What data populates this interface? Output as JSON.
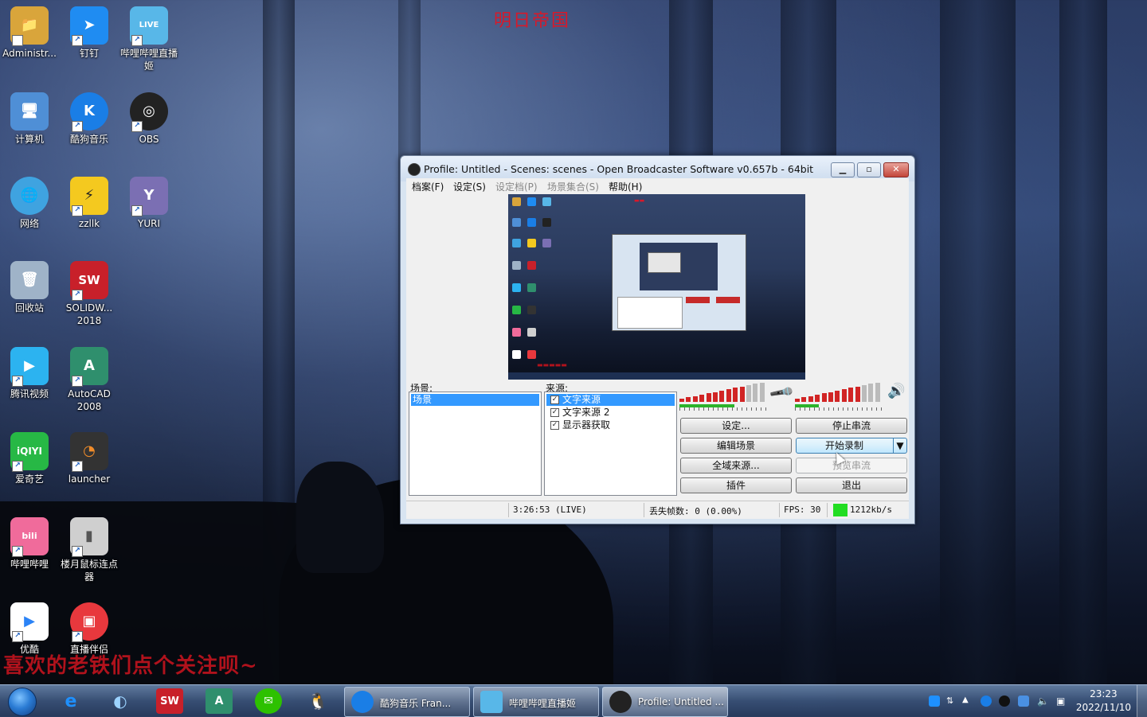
{
  "desktop": {
    "title_text": "明日帝国",
    "banner_text": "喜欢的老铁们点个关注呗~",
    "icons": [
      {
        "label": "Administr...",
        "icon": "user-folder-icon",
        "color": "#d9a53b"
      },
      {
        "label": "钉钉",
        "icon": "dingtalk-icon",
        "color": "#1f8cf2"
      },
      {
        "label": "哔哩哔哩直播姬",
        "icon": "bilibili-live-icon",
        "color": "#58b7e8"
      },
      {
        "label": "计算机",
        "icon": "computer-icon",
        "color": "#4f8fd6"
      },
      {
        "label": "酷狗音乐",
        "icon": "kugou-icon",
        "color": "#1a7ee6"
      },
      {
        "label": "OBS",
        "icon": "obs-icon",
        "color": "#222222"
      },
      {
        "label": "网络",
        "icon": "network-icon",
        "color": "#3fa3e0"
      },
      {
        "label": "zzllk",
        "icon": "pikachu-icon",
        "color": "#f4c91f"
      },
      {
        "label": "YURI",
        "icon": "yuri-icon",
        "color": "#7b6fb3"
      },
      {
        "label": "回收站",
        "icon": "recycle-bin-icon",
        "color": "#9fb3c8"
      },
      {
        "label": "SOLIDW... 2018",
        "icon": "solidworks-icon",
        "color": "#c8202a"
      },
      {
        "label": "腾讯视频",
        "icon": "tencent-video-icon",
        "color": "#2cb3f0"
      },
      {
        "label": "AutoCAD 2008",
        "icon": "autocad-icon",
        "color": "#2f8f6d"
      },
      {
        "label": "爱奇艺",
        "icon": "iqiyi-icon",
        "color": "#27b845"
      },
      {
        "label": "launcher",
        "icon": "launcher-icon",
        "color": "#333333"
      },
      {
        "label": "哔哩哔哩",
        "icon": "bilibili-icon",
        "color": "#f06b9b"
      },
      {
        "label": "楼月鼠标连点器",
        "icon": "mouse-clicker-icon",
        "color": "#cfcfcf"
      },
      {
        "label": "优酷",
        "icon": "youku-icon",
        "color": "#2b83f6"
      },
      {
        "label": "直播伴侣",
        "icon": "live-companion-icon",
        "color": "#e8383d"
      }
    ]
  },
  "obs": {
    "title": "Profile: Untitled - Scenes: scenes - Open Broadcaster Software v0.657b - 64bit",
    "menu": [
      "档案(F)",
      "设定(S)",
      "设定档(P)",
      "场景集合(S)",
      "帮助(H)"
    ],
    "scenes_label": "场景:",
    "sources_label": "来源:",
    "scenes": [
      "场景"
    ],
    "sources": [
      {
        "name": "文字来源",
        "checked": true,
        "selected": true
      },
      {
        "name": "文字来源 2",
        "checked": true,
        "selected": false
      },
      {
        "name": "显示器获取",
        "checked": true,
        "selected": false
      }
    ],
    "buttons": {
      "settings": "设定...",
      "stop_stream": "停止串流",
      "edit_scene": "编辑场景",
      "start_recording": "开始录制",
      "global_sources": "全域来源...",
      "preview_stream": "预览串流",
      "plugins": "插件",
      "exit": "退出"
    },
    "mic_level": 0.72,
    "desktop_level": 0.68,
    "status": {
      "time": "3:26:53 (LIVE)",
      "dropped": "丢失帧数: 0 (0.00%)",
      "fps": "FPS: 30",
      "bitrate": "1212kb/s",
      "bitrate_color": "#22dd22"
    }
  },
  "taskbar": {
    "tasks": [
      {
        "label": "酷狗音乐 Fran...",
        "icon": "kugou-icon"
      },
      {
        "label": "哔哩哔哩直播姬",
        "icon": "bilibili-live-icon"
      },
      {
        "label": "Profile: Untitled ...",
        "icon": "obs-icon"
      }
    ],
    "time": "23:23",
    "date": "2022/11/10"
  }
}
